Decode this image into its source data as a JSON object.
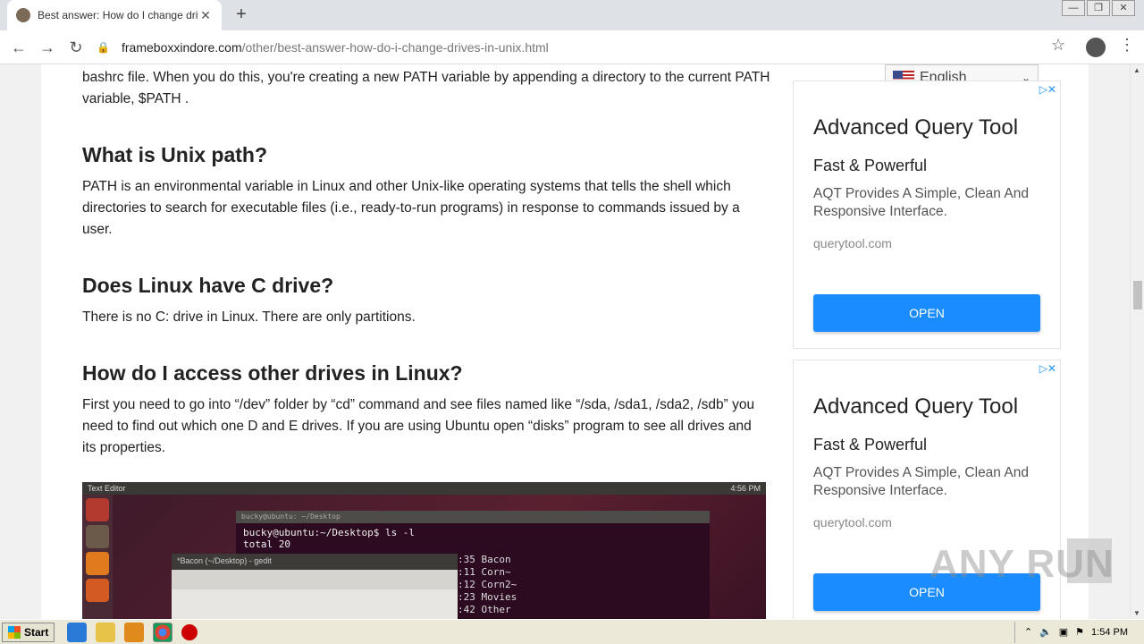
{
  "browser": {
    "tab_title": "Best answer: How do I change drive",
    "tab_close": "✕",
    "new_tab": "+",
    "url_host": "frameboxxindore.com",
    "url_path": "/other/best-answer-how-do-i-change-drives-in-unix.html",
    "window_controls": [
      "—",
      "❐",
      "✕"
    ]
  },
  "article": {
    "intro": "bashrc file. When you do this, you're creating a new PATH variable by appending a directory to the current PATH variable, $PATH .",
    "sections": [
      {
        "heading": "What is Unix path?",
        "body": "PATH is an environmental variable in Linux and other Unix-like operating systems that tells the shell which directories to search for executable files (i.e., ready-to-run programs) in response to commands issued by a user."
      },
      {
        "heading": "Does Linux have C drive?",
        "body": "There is no C: drive in Linux. There are only partitions."
      },
      {
        "heading": "How do I access other drives in Linux?",
        "body": "First you need to go into “/dev” folder by “cd” command and see files named like “/sda, /sda1, /sda2, /sdb” you need to find out which one D and E drives. If you are using Ubuntu open “disks” program to see all drives and its properties."
      }
    ],
    "screenshot": {
      "topbar": "Text Editor",
      "time": "4:56 PM",
      "term_title": "bucky@ubuntu: ~/Desktop",
      "prompt": "bucky@ubuntu:~/Desktop$ ls -l",
      "total": "total 20",
      "gedit_title": "*Bacon (~/Desktop) - gedit",
      "listing": [
        ":35 Bacon",
        ":11 Corn~",
        ":12 Corn2~",
        ":23 Movies",
        ":42 Other"
      ]
    }
  },
  "language": {
    "label": "English"
  },
  "ads": [
    {
      "title": "Advanced Query Tool",
      "subtitle": "Fast & Powerful",
      "desc": "AQT Provides A Simple, Clean And Responsive Interface.",
      "domain": "querytool.com",
      "button": "OPEN"
    },
    {
      "title": "Advanced Query Tool",
      "subtitle": "Fast & Powerful",
      "desc": "AQT Provides A Simple, Clean And Responsive Interface.",
      "domain": "querytool.com",
      "button": "OPEN"
    }
  ],
  "watermark": "ANY RUN",
  "taskbar": {
    "start": "Start",
    "clock": "1:54 PM"
  }
}
